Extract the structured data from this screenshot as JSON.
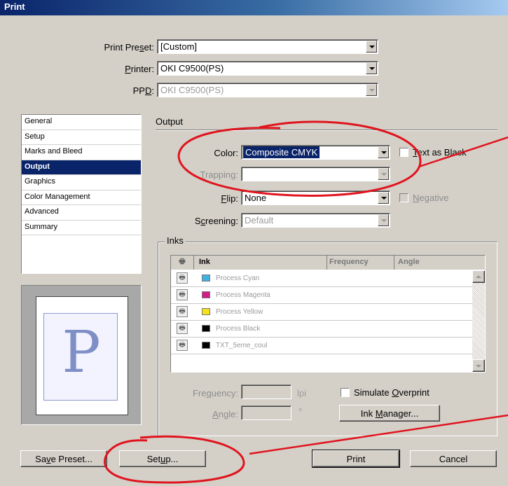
{
  "window": {
    "title": "Print"
  },
  "print_preset": {
    "label_pre": "Print Pre",
    "label_u": "s",
    "label_post": "et:",
    "value": "[Custom]"
  },
  "printer": {
    "label_u": "P",
    "label_post": "rinter:",
    "value": "OKI C9500(PS)"
  },
  "ppd": {
    "label_pre": "PP",
    "label_u": "D",
    "label_post": ":",
    "value": "OKI C9500(PS)"
  },
  "nav": {
    "items": [
      "General",
      "Setup",
      "Marks and Bleed",
      "Output",
      "Graphics",
      "Color Management",
      "Advanced",
      "Summary"
    ],
    "active": "Output"
  },
  "output": {
    "section_title": "Output",
    "color": {
      "label_pre": "Color:",
      "value": "Composite CMYK"
    },
    "text_as_black": {
      "label_u": "T",
      "label_post": "ext as Black",
      "checked": false
    },
    "trapping": {
      "label_u": "T",
      "label_post": "rapping:",
      "value": ""
    },
    "flip": {
      "label_u": "F",
      "label_post": "lip:",
      "value": "None"
    },
    "negative": {
      "label_u": "N",
      "label_post": "egative",
      "checked": false
    },
    "screening": {
      "label_pre": "S",
      "label_u": "c",
      "label_post": "reening:",
      "value": "Default"
    }
  },
  "inks": {
    "group_title": "Inks",
    "columns": {
      "ink": "Ink",
      "frequency": "Frequency",
      "angle": "Angle"
    },
    "rows": [
      {
        "name": "Process Cyan",
        "color": "#3fb2e0"
      },
      {
        "name": "Process Magenta",
        "color": "#d41c86"
      },
      {
        "name": "Process Yellow",
        "color": "#f6e21a"
      },
      {
        "name": "Process Black",
        "color": "#000000"
      },
      {
        "name": "TXT_5eme_coul",
        "color": "#000000"
      }
    ],
    "frequency": {
      "label_pre": "Fre",
      "label_u": "q",
      "label_post": "uency:",
      "value": "",
      "unit": "lpi"
    },
    "angle": {
      "label_u": "A",
      "label_post": "ngle:",
      "value": "",
      "unit": "°"
    },
    "simulate_overprint": {
      "label_pre": "Simulate ",
      "label_u": "O",
      "label_post": "verprint",
      "checked": false
    },
    "ink_manager": {
      "label_pre": "Ink ",
      "label_u": "M",
      "label_post": "anager..."
    }
  },
  "preview": {
    "letter": "P"
  },
  "buttons": {
    "save_preset": {
      "label_pre": "Sa",
      "label_u": "v",
      "label_post": "e Preset..."
    },
    "setup": {
      "label_pre": "Set",
      "label_u": "u",
      "label_post": "p..."
    },
    "print": "Print",
    "cancel": "Cancel"
  },
  "colors": {
    "title_bar": "#0a246a",
    "dialog_bg": "#d4d0c8",
    "selection": "#0a246a",
    "annotation": "#e0141e",
    "preview_letter": "#7e8fc6"
  }
}
